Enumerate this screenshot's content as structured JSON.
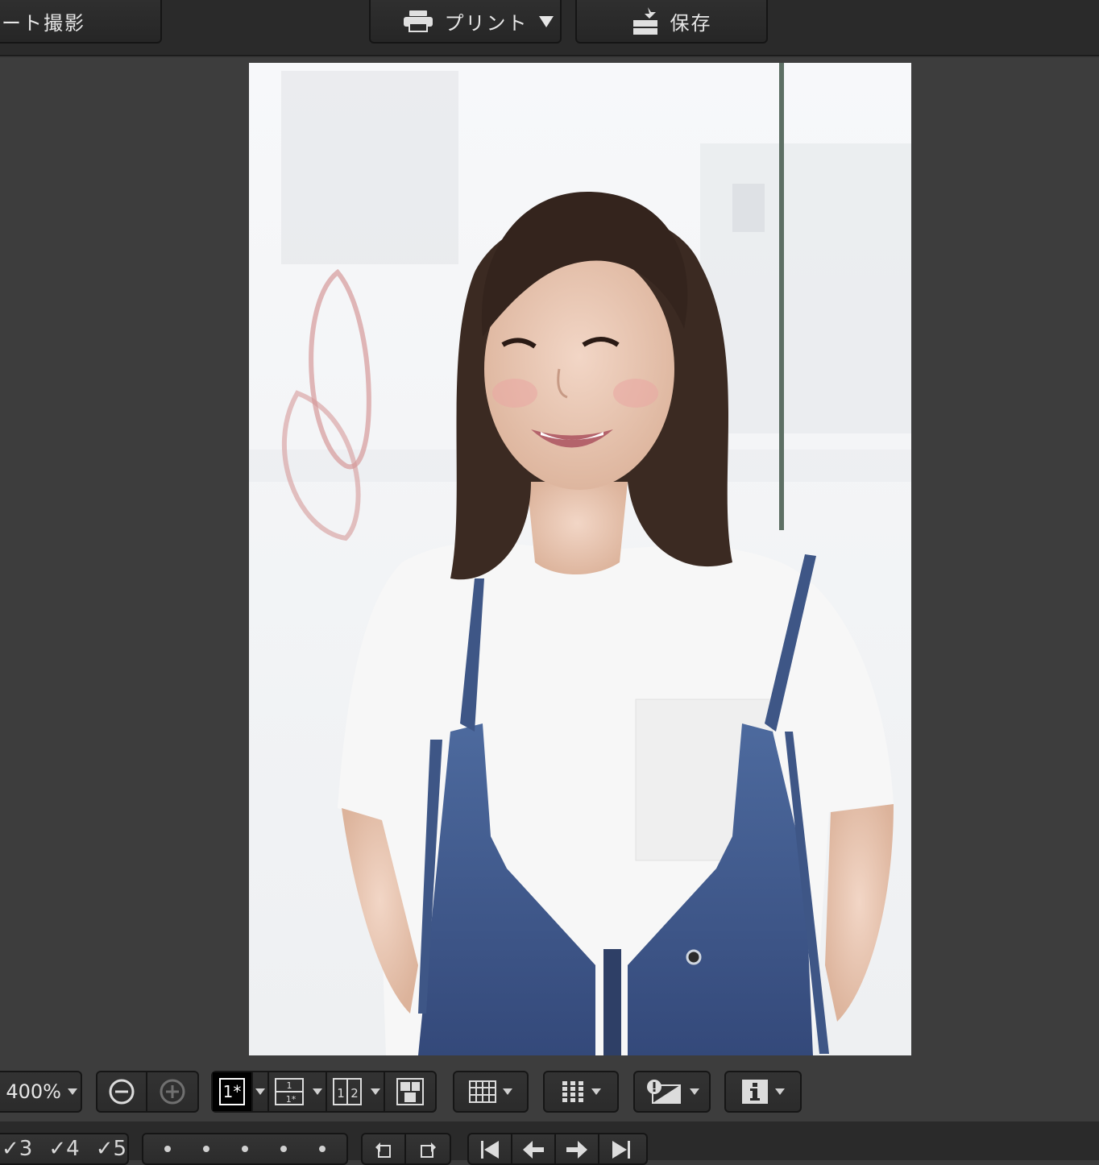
{
  "toolbar": {
    "tether_label": "ート撮影",
    "print_label": "プリント",
    "save_label": "保存"
  },
  "controls": {
    "zoom_value": "400%",
    "layout_single": "1*",
    "layout_split_v": "1 / 1*",
    "layout_split_h": "1|2"
  },
  "ratings": {
    "items": [
      "3",
      "4",
      "5"
    ]
  },
  "colors": {
    "toolbar_bg": "#2a2a2a",
    "viewer_bg": "#3d3d3d",
    "selected_bg": "#000000"
  }
}
